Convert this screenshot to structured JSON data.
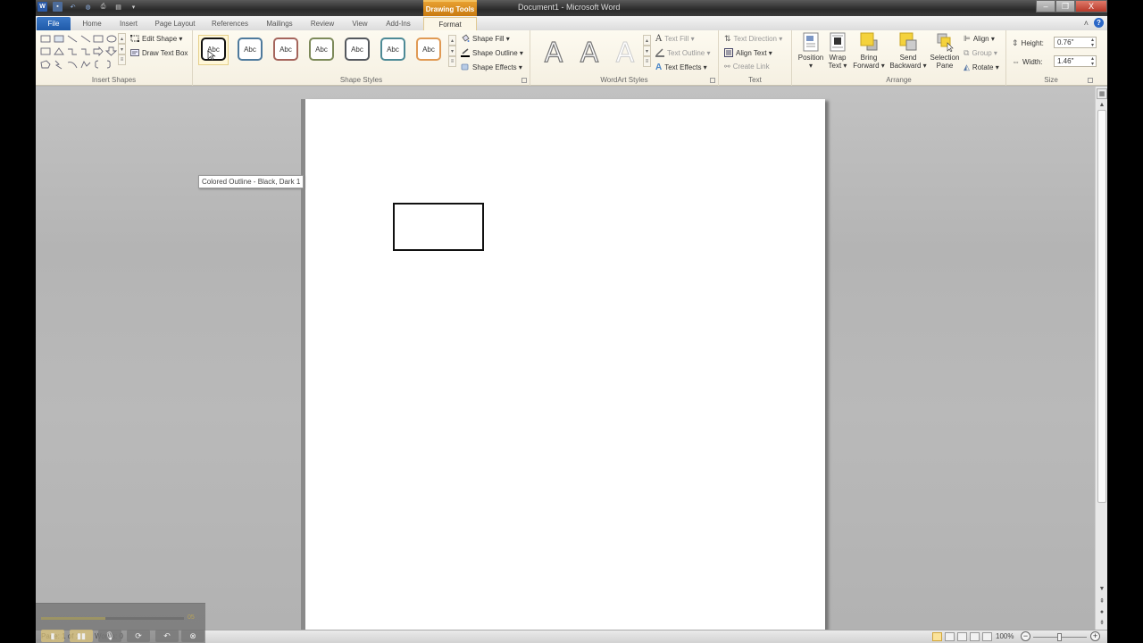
{
  "window": {
    "title": "Document1 - Microsoft Word",
    "contextual_tab_group": "Drawing Tools",
    "controls": {
      "minimize": "–",
      "restore": "❐",
      "close": "X"
    }
  },
  "quick_access": [
    {
      "name": "word-logo-icon",
      "glyph": "W"
    },
    {
      "name": "save-icon",
      "glyph": "▪"
    },
    {
      "name": "undo-icon",
      "glyph": "↶"
    },
    {
      "name": "repeat-icon",
      "glyph": "◍"
    },
    {
      "name": "print-preview-icon",
      "glyph": "⎙"
    },
    {
      "name": "new-doc-icon",
      "glyph": "▤"
    },
    {
      "name": "customize-qat-icon",
      "glyph": "▾"
    }
  ],
  "tabs": [
    {
      "label": "File"
    },
    {
      "label": "Home"
    },
    {
      "label": "Insert"
    },
    {
      "label": "Page Layout"
    },
    {
      "label": "References"
    },
    {
      "label": "Mailings"
    },
    {
      "label": "Review"
    },
    {
      "label": "View"
    },
    {
      "label": "Add-Ins"
    },
    {
      "label": "Format",
      "active": true
    }
  ],
  "ribbon": {
    "insert_shapes": {
      "label": "Insert Shapes",
      "edit_shape": "Edit Shape ▾",
      "draw_text_box": "Draw Text Box"
    },
    "shape_styles": {
      "label": "Shape Styles",
      "styles": [
        {
          "text": "Abc",
          "color": "#111111"
        },
        {
          "text": "Abc",
          "color": "#4f7a9c"
        },
        {
          "text": "Abc",
          "color": "#a5655c"
        },
        {
          "text": "Abc",
          "color": "#7d8a5a"
        },
        {
          "text": "Abc",
          "color": "#55595e"
        },
        {
          "text": "Abc",
          "color": "#4d8a96"
        },
        {
          "text": "Abc",
          "color": "#e09a54"
        }
      ],
      "shape_fill": "Shape Fill ▾",
      "shape_outline": "Shape Outline ▾",
      "shape_effects": "Shape Effects ▾"
    },
    "wordart_styles": {
      "label": "WordArt Styles",
      "letters": [
        "A",
        "A",
        "A"
      ],
      "text_fill": "Text Fill ▾",
      "text_outline": "Text Outline ▾",
      "text_effects": "Text Effects ▾"
    },
    "text": {
      "label": "Text",
      "text_direction": "Text Direction ▾",
      "align_text": "Align Text ▾",
      "create_link": "Create Link"
    },
    "arrange": {
      "label": "Arrange",
      "position": [
        "Position",
        "▾"
      ],
      "wrap_text": [
        "Wrap",
        "Text ▾"
      ],
      "bring_forward": [
        "Bring",
        "Forward ▾"
      ],
      "send_backward": [
        "Send",
        "Backward ▾"
      ],
      "selection_pane": [
        "Selection",
        "Pane"
      ],
      "align": "Align ▾",
      "group": "Group ▾",
      "rotate": "Rotate ▾"
    },
    "size": {
      "label": "Size",
      "height_label": "Height:",
      "height_value": "0.76\"",
      "width_label": "Width:",
      "width_value": "1.46\""
    }
  },
  "tooltip": "Colored Outline - Black, Dark 1",
  "status": {
    "page": "Page: 1 of 1",
    "words": "Words: 0",
    "zoom": "100%",
    "zoom_fraction": 0.5
  },
  "recorder": {
    "time": "05",
    "progress": 0.45
  }
}
